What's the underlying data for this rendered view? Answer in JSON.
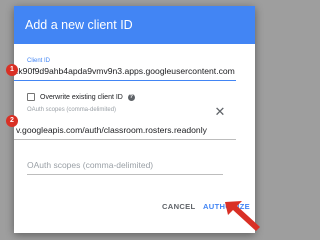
{
  "dialog": {
    "title": "Add a new client ID",
    "client_id_label": "Client ID",
    "client_id_value": ":k90f9d9ahb4apda9vmv9n3.apps.googleusercontent.com",
    "overwrite_label": "Overwrite existing client ID",
    "overwrite_checked": false,
    "scope_label": "OAuth scopes (comma-delimited)",
    "scope_value": "v.googleapis.com/auth/classroom.rosters.readonly",
    "scope_placeholder": "OAuth scopes (comma-delimited)",
    "cancel_label": "CANCEL",
    "authorize_label": "AUTHORIZE"
  },
  "annotations": {
    "badge_1": "1",
    "badge_2": "2"
  },
  "colors": {
    "accent": "#4285f4",
    "header": "#4285f4",
    "badge": "#d93025",
    "arrow": "#d93025",
    "overlay": "#9e9e9e"
  },
  "icons": {
    "help": "help-circle-icon",
    "remove": "close-icon",
    "arrow": "red-arrow-annotation"
  }
}
